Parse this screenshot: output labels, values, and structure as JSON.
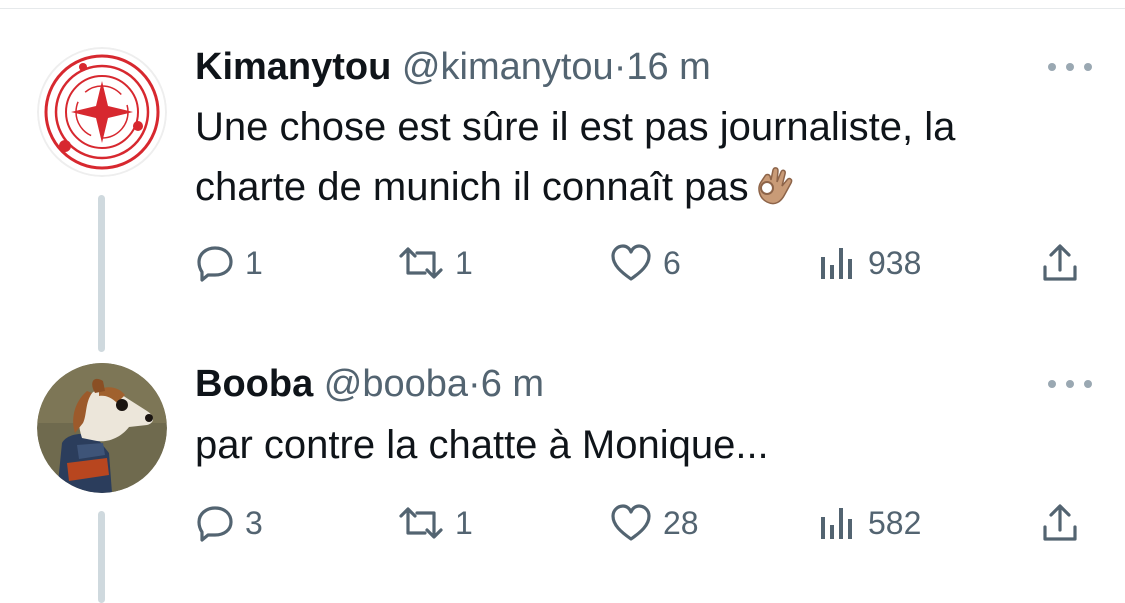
{
  "tweets": [
    {
      "name": "Kimanytou",
      "handle": "@kimanytou",
      "separator": "·",
      "time": "16 m",
      "text_lines": [
        "Une chose est sûre il est pas journaliste, la",
        "charte de munich il connaît pas"
      ],
      "emoji": "ok-hand-emoji",
      "avatar": "red-orbit-logo",
      "stats": {
        "replies": "1",
        "retweets": "1",
        "likes": "6",
        "views": "938"
      }
    },
    {
      "name": "Booba",
      "handle": "@booba",
      "separator": "·",
      "time": "6 m",
      "text_lines": [
        "par contre la chatte à Monique..."
      ],
      "avatar": "dog-portrait-painting",
      "stats": {
        "replies": "3",
        "retweets": "1",
        "likes": "28",
        "views": "582"
      }
    }
  ],
  "icons": {
    "more": "more-dots-icon",
    "reply": "reply-icon",
    "retweet": "retweet-icon",
    "like": "heart-icon",
    "views": "views-icon",
    "share": "share-icon"
  },
  "colors": {
    "text": "#0f1419",
    "secondary": "#536471",
    "thread_line": "#cfd9de",
    "logo_red": "#d7282f"
  }
}
